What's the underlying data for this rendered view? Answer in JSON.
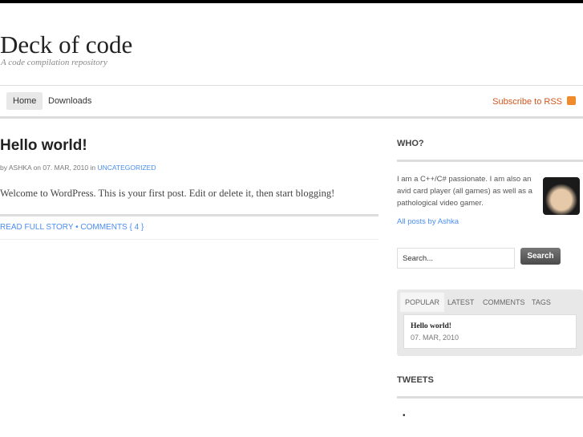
{
  "site": {
    "title": "Deck of code",
    "tagline": "A code compilation repository"
  },
  "nav": {
    "items": [
      "Home",
      "Downloads"
    ],
    "rss": "Subscribe to RSS"
  },
  "post": {
    "title": "Hello world!",
    "by": "by ASHKA on 07. MAR, 2010 in ",
    "category": "UNCATEGORIZED",
    "body": "Welcome to WordPress. This is your first post. Edit or delete it, then start blogging!",
    "read_more": "READ FULL STORY",
    "dot": " • ",
    "comments": "COMMENTS { 4 }"
  },
  "sidebar": {
    "who_heading": "WHO?",
    "who_text": "I am a C++/C# passionate. I am also an avid card player (all games) as well as a pathological video gamer.",
    "all_posts": "All posts by Ashka",
    "search_value": "Search...",
    "search_button": "Search",
    "tabs": [
      "POPULAR",
      "LATEST",
      "COMMENTS",
      "TAGS"
    ],
    "popular_title": "Hello world!",
    "popular_date": "07. MAR, 2010",
    "tweets_heading": "TWEETS",
    "tweet_bullet": "•"
  }
}
